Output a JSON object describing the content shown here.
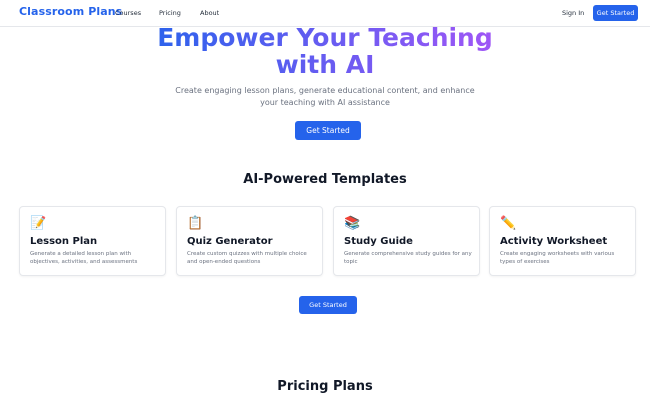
{
  "nav": {
    "brand": "Classroom Plans",
    "links": [
      "Courses",
      "Pricing",
      "About"
    ],
    "signin": "Sign In",
    "cta": "Get Started"
  },
  "hero": {
    "title_line1": "Empower Your Teaching",
    "title_line2": "with AI",
    "subtitle": "Create engaging lesson plans, generate educational content, and enhance your teaching with AI assistance",
    "cta": "Get Started",
    "gradient": [
      "#2563eb",
      "#a855f7"
    ]
  },
  "templates": {
    "title": "AI-Powered Templates",
    "cards": [
      {
        "icon": "memo-icon",
        "emoji": "📝",
        "title": "Lesson Plan",
        "desc": "Generate a detailed lesson plan with objectives, activities, and assessments"
      },
      {
        "icon": "clipboard-icon",
        "emoji": "📋",
        "title": "Quiz Generator",
        "desc": "Create custom quizzes with multiple choice and open-ended questions"
      },
      {
        "icon": "books-icon",
        "emoji": "📚",
        "title": "Study Guide",
        "desc": "Generate comprehensive study guides for any topic"
      },
      {
        "icon": "pencil-icon",
        "emoji": "✏️",
        "title": "Activity Worksheet",
        "desc": "Create engaging worksheets with various types of exercises"
      }
    ],
    "cta": "Get Started"
  },
  "pricing": {
    "title": "Pricing Plans"
  },
  "colors": {
    "accent": "#2563eb",
    "muted_text": "#6b7280",
    "border": "#e5e7eb"
  }
}
